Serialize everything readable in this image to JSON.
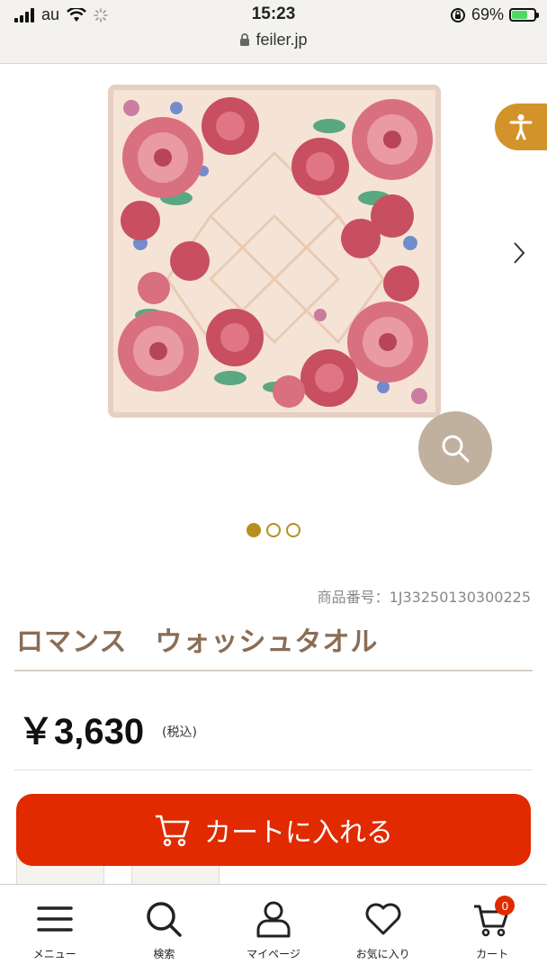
{
  "status_bar": {
    "carrier": "au",
    "time": "15:23",
    "url": "feiler.jp",
    "battery_percent": "69%",
    "battery_level": 0.69
  },
  "product": {
    "image_icon": "floral-towel-image",
    "gallery": {
      "page_count": 3,
      "active_index": 0
    },
    "code_label": "商品番号：1J33250130300225",
    "name": "ロマンス　ウォッシュタオル",
    "price": "￥3,630",
    "tax_note": "(税込)",
    "add_to_cart_label": "カートに入れる"
  },
  "bottom_nav": {
    "items": [
      {
        "label": "メニュー",
        "icon": "menu-icon"
      },
      {
        "label": "検索",
        "icon": "search-icon"
      },
      {
        "label": "マイページ",
        "icon": "user-icon"
      },
      {
        "label": "お気に入り",
        "icon": "heart-icon"
      },
      {
        "label": "カート",
        "icon": "cart-icon"
      }
    ],
    "cart_count": "0"
  },
  "colors": {
    "accent_red": "#e12a00",
    "gold": "#b78f1f",
    "name_brown": "#8a6d55",
    "accessibility_orange": "#d3932b",
    "zoom_tan": "#c0b19e"
  }
}
